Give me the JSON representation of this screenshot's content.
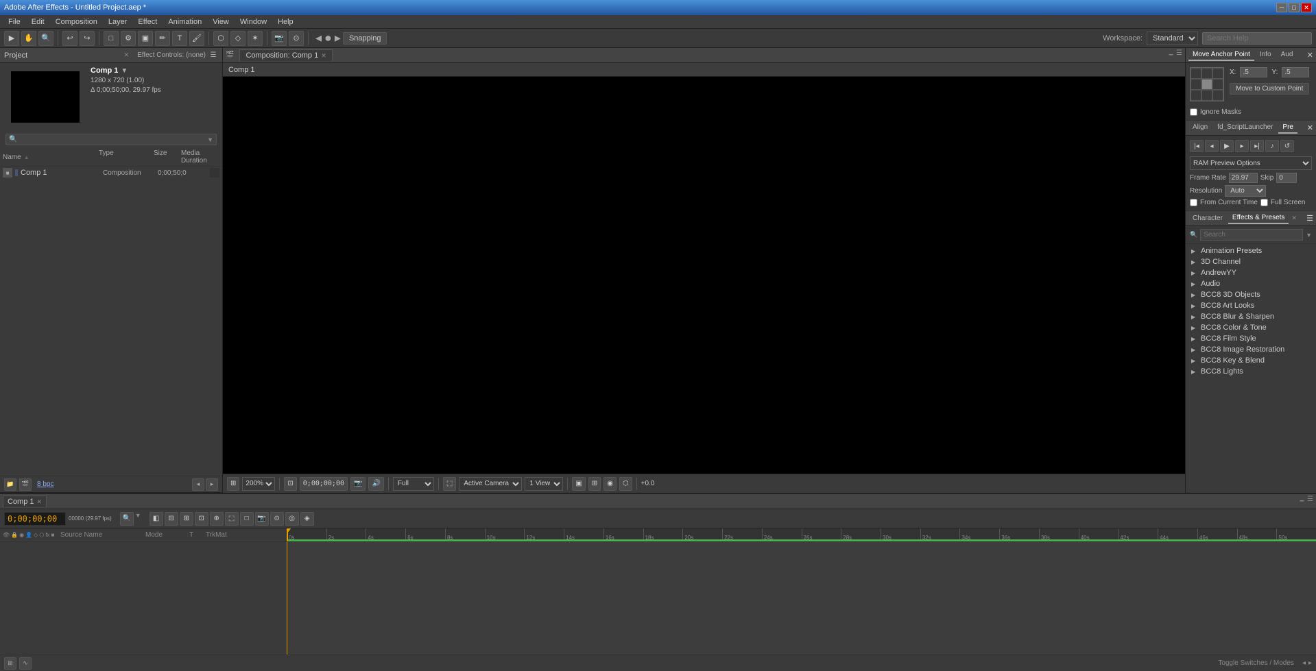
{
  "app": {
    "title": "Adobe After Effects - Untitled Project.aep *",
    "version": "Adobe After Effects"
  },
  "titlebar": {
    "title": "Adobe After Effects - Untitled Project.aep *",
    "minimize": "─",
    "maximize": "□",
    "close": "✕"
  },
  "menubar": {
    "items": [
      "File",
      "Edit",
      "Composition",
      "Layer",
      "Effect",
      "Animation",
      "View",
      "Window",
      "Help"
    ]
  },
  "toolbar": {
    "snapping": "Snapping",
    "workspace_label": "Workspace:",
    "workspace_value": "Standard",
    "search_placeholder": "Search Help"
  },
  "project_panel": {
    "title": "Project",
    "effect_controls": "Effect Controls: (none)",
    "comp_name": "Comp 1",
    "comp_details": "1280 x 720 (1.00)",
    "comp_duration": "Δ 0;00;50;00, 29.97 fps",
    "columns": {
      "name": "Name",
      "type": "Type",
      "size": "Size",
      "duration": "Media Duration"
    },
    "items": [
      {
        "icon": "comp",
        "name": "Comp 1",
        "type": "Composition",
        "size": "",
        "duration": "0;00;50;0"
      }
    ],
    "bpc": "8 bpc"
  },
  "composition_panel": {
    "title": "Composition: Comp 1",
    "tab_name": "Comp 1",
    "viewer_tab": "Comp 1"
  },
  "viewer_toolbar": {
    "zoom": "200%",
    "time": "0;00;00;00",
    "full_label": "Full",
    "active_camera": "Active Camera",
    "one_view": "1 View",
    "audio_value": "+0.0"
  },
  "right_panel": {
    "tabs": {
      "move_anchor": "Move Anchor Point",
      "info": "Info",
      "audio": "Aud"
    },
    "anchor": {
      "x_label": "X:",
      "x_value": ".5",
      "y_label": "Y:",
      "y_value": ".5",
      "move_to_custom": "Move to Custom Point",
      "ignore_masks": "Ignore Masks"
    },
    "mid_tabs": {
      "align": "Align",
      "script_launcher": "fd_ScriptLauncher",
      "pre": "Pre"
    },
    "preview": {
      "ram_preview": "RAM Preview Options",
      "frame_rate_label": "Frame Rate",
      "skip_label": "Skip",
      "resolution_label": "Resolution",
      "frame_rate_value": "29.97",
      "skip_value": "0",
      "resolution_value": "Auto",
      "from_current": "From Current Time",
      "full_screen": "Full Screen"
    },
    "effects_tabs": {
      "character": "Character",
      "effects_presets": "Effects & Presets"
    },
    "effects": {
      "search_placeholder": "Search",
      "items": [
        "Animation Presets",
        "3D Channel",
        "AndrewYY",
        "Audio",
        "BCC8 3D Objects",
        "BCC8 Art Looks",
        "BCC8 Blur & Sharpen",
        "BCC8 Color & Tone",
        "BCC8 Film Style",
        "BCC8 Image Restoration",
        "BCC8 Key & Blend",
        "BCC8 Lights"
      ]
    }
  },
  "timeline": {
    "tab": "Comp 1",
    "time_display": "0;00;00;00",
    "fps_display": "00000 (29.97 fps)",
    "search_placeholder": "",
    "columns": {
      "source_name": "Source Name",
      "mode": "Mode",
      "t": "T",
      "trkmat": "TrkMat"
    },
    "ruler_ticks": [
      "0s",
      "2s",
      "4s",
      "6s",
      "8s",
      "10s",
      "12s",
      "14s",
      "16s",
      "18s",
      "20s",
      "22s",
      "24s",
      "26s",
      "28s",
      "30s",
      "32s",
      "34s",
      "36s",
      "38s",
      "40s",
      "42s",
      "44s",
      "46s",
      "48s",
      "50s"
    ]
  },
  "colors": {
    "accent_orange": "#e8a000",
    "accent_blue": "#4a90d9",
    "accent_green": "#4CAF50",
    "bg_dark": "#2a2a2a",
    "bg_mid": "#3a3a3a",
    "bg_panel": "#444444"
  }
}
